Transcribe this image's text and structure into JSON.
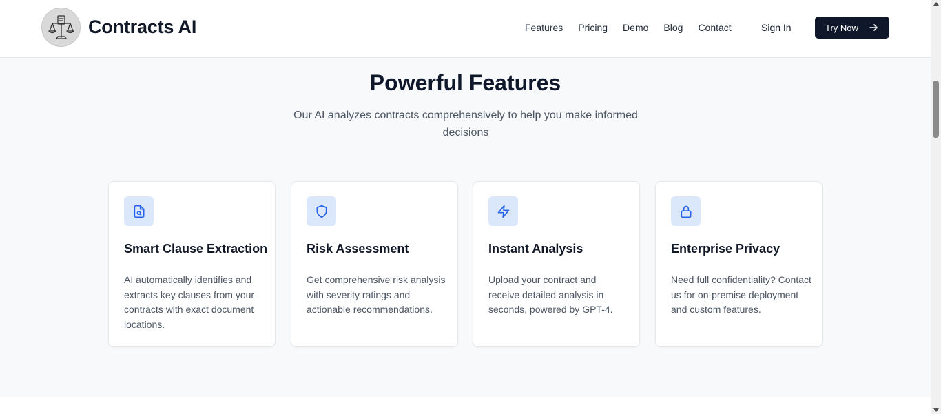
{
  "header": {
    "brand_name": "Contracts AI",
    "nav": [
      "Features",
      "Pricing",
      "Demo",
      "Blog",
      "Contact"
    ],
    "sign_in": "Sign In",
    "cta": "Try Now"
  },
  "section": {
    "title": "Powerful Features",
    "subtitle": "Our AI analyzes contracts comprehensively to help you make informed decisions"
  },
  "features": [
    {
      "icon": "document-search-icon",
      "title": "Smart Clause Extraction",
      "description": "AI automatically identifies and extracts key clauses from your contracts with exact document locations."
    },
    {
      "icon": "shield-icon",
      "title": "Risk Assessment",
      "description": "Get comprehensive risk analysis with severity ratings and actionable recommendations."
    },
    {
      "icon": "lightning-icon",
      "title": "Instant Analysis",
      "description": "Upload your contract and receive detailed analysis in seconds, powered by GPT-4."
    },
    {
      "icon": "lock-icon",
      "title": "Enterprise Privacy",
      "description": "Need full confidentiality? Contact us for on-premise deployment and custom features."
    }
  ],
  "colors": {
    "accent": "#2563eb",
    "icon_bg": "#dbe7fb",
    "cta_bg": "#0f172a",
    "page_bg": "#f7f9fb"
  }
}
